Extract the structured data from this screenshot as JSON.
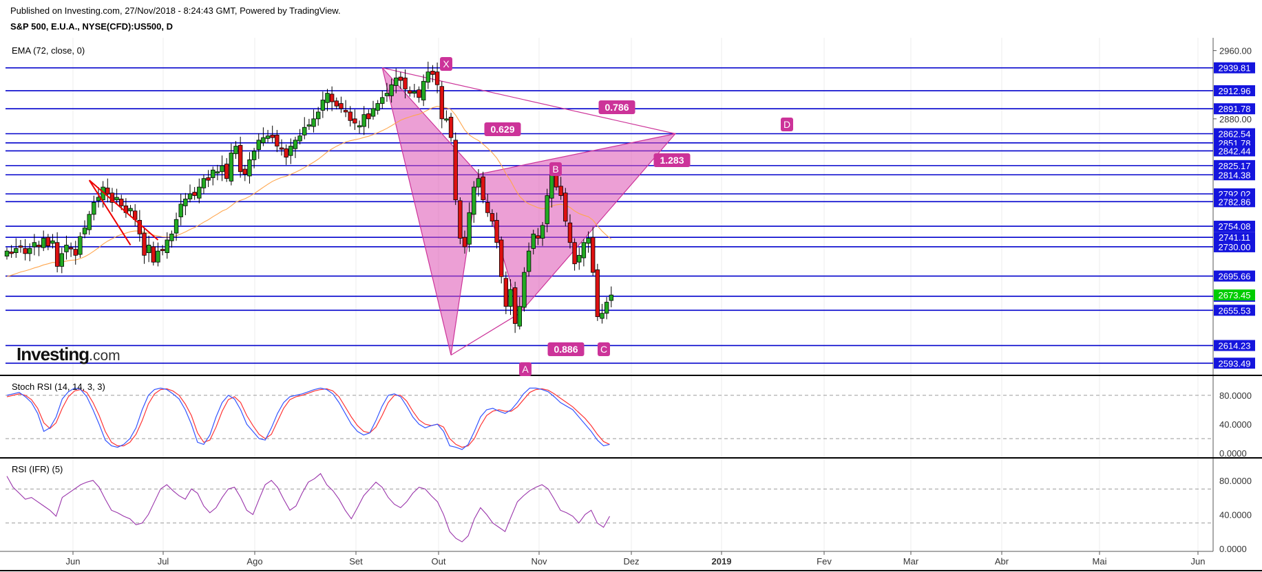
{
  "header": {
    "published": "Published on Investing.com, 27/Nov/2018 - 8:24:43 GMT, Powered by TradingView.",
    "symbol": "S&P 500, E.U.A., NYSE(CFD):US500, D"
  },
  "logo": {
    "main": "Investing",
    "suffix": ".com"
  },
  "colors": {
    "hline": "#0000cc",
    "up": "#22aa22",
    "down": "#dd1111",
    "pattern": "#cc3399",
    "pattern_fill": "rgba(221,80,178,0.55)",
    "ema": "#ffa64d",
    "stoch_k": "#3355ff",
    "stoch_d": "#ff3333",
    "rsi": "#9933aa",
    "current_badge": "#00cc00"
  },
  "main_pane": {
    "indicator_label": "EMA (72, close, 0)",
    "y_ticks": [
      "2960.00",
      "2880.00"
    ],
    "price_levels": [
      "2939.81",
      "2912.96",
      "2891.78",
      "2862.54",
      "2851.78",
      "2842.44",
      "2825.17",
      "2814.38",
      "2792.02",
      "2782.86",
      "2754.08",
      "2741.11",
      "2730.00",
      "2695.66",
      "2671.97",
      "2655.53",
      "2614.23",
      "2593.49"
    ],
    "current_price": "2673.45",
    "pattern_points": [
      "X",
      "A",
      "B",
      "C",
      "D"
    ],
    "ratios": [
      "0.629",
      "0.786",
      "1.283",
      "0.886"
    ]
  },
  "stoch_pane": {
    "label": "Stoch RSI (14, 14, 3, 3)",
    "y_ticks": [
      "80.0000",
      "40.0000",
      "0.0000"
    ]
  },
  "rsi_pane": {
    "label": "RSI (IFR) (5)",
    "y_ticks": [
      "80.0000",
      "40.0000",
      "0.0000"
    ]
  },
  "x_axis": {
    "labels": [
      "Jun",
      "Jul",
      "Ago",
      "Set",
      "Out",
      "Nov",
      "Dez",
      "2019",
      "Fev",
      "Mar",
      "Abr",
      "Mai",
      "Jun"
    ]
  },
  "chart_data": {
    "type": "candlestick",
    "symbol": "S&P 500, E.U.A., NYSE(CFD):US500, D",
    "candles_close": [
      2725,
      2722,
      2728,
      2730,
      2722,
      2728,
      2735,
      2730,
      2740,
      2731,
      2737,
      2707,
      2722,
      2732,
      2728,
      2720,
      2742,
      2752,
      2768,
      2782,
      2788,
      2800,
      2792,
      2782,
      2788,
      2778,
      2770,
      2775,
      2762,
      2745,
      2720,
      2732,
      2712,
      2725,
      2726,
      2738,
      2745,
      2762,
      2780,
      2786,
      2792,
      2790,
      2800,
      2810,
      2808,
      2820,
      2818,
      2825,
      2810,
      2840,
      2848,
      2818,
      2815,
      2832,
      2842,
      2855,
      2858,
      2860,
      2858,
      2848,
      2845,
      2835,
      2848,
      2855,
      2860,
      2870,
      2873,
      2880,
      2888,
      2902,
      2910,
      2900,
      2895,
      2892,
      2888,
      2878,
      2875,
      2872,
      2885,
      2880,
      2892,
      2898,
      2905,
      2910,
      2920,
      2928,
      2925,
      2915,
      2910,
      2912,
      2905,
      2924,
      2935,
      2932,
      2920,
      2880,
      2880,
      2858,
      2785,
      2740,
      2730,
      2770,
      2800,
      2810,
      2785,
      2770,
      2760,
      2735,
      2695,
      2660,
      2680,
      2640,
      2660,
      2700,
      2725,
      2745,
      2740,
      2755,
      2790,
      2815,
      2800,
      2790,
      2760,
      2735,
      2710,
      2720,
      2735,
      2740,
      2700,
      2648,
      2652,
      2665,
      2673.45
    ],
    "ema_72_approx": {
      "start": 2695,
      "oct_peak": 2870,
      "end": 2792
    },
    "harmonic_pattern": {
      "points": [
        {
          "label": "X",
          "price": 2939.81
        },
        {
          "label": "A",
          "price": 2603
        },
        {
          "label": "B",
          "price": 2815
        },
        {
          "label": "C",
          "price": 2652
        },
        {
          "label": "D",
          "price": 2862.54
        }
      ],
      "ratios": {
        "XB": "0.629",
        "XD": "0.786",
        "BD": "1.283",
        "AC": "0.886"
      }
    },
    "stoch_rsi_k": [
      80,
      82,
      84,
      78,
      70,
      55,
      30,
      35,
      50,
      75,
      85,
      90,
      88,
      78,
      60,
      40,
      18,
      10,
      8,
      12,
      20,
      35,
      60,
      80,
      88,
      90,
      88,
      82,
      75,
      60,
      40,
      15,
      12,
      25,
      50,
      70,
      80,
      75,
      60,
      40,
      30,
      20,
      18,
      35,
      55,
      70,
      78,
      80,
      82,
      85,
      88,
      90,
      88,
      82,
      70,
      55,
      40,
      30,
      25,
      28,
      45,
      65,
      80,
      82,
      78,
      65,
      50,
      40,
      35,
      38,
      40,
      30,
      10,
      8,
      5,
      12,
      30,
      50,
      60,
      62,
      58,
      55,
      60,
      70,
      82,
      90,
      90,
      88,
      85,
      78,
      70,
      65,
      60,
      50,
      40,
      30,
      18,
      10,
      12
    ],
    "stoch_rsi_d": [
      78,
      80,
      82,
      80,
      74,
      62,
      42,
      34,
      42,
      62,
      78,
      86,
      88,
      84,
      70,
      52,
      30,
      15,
      10,
      10,
      15,
      26,
      45,
      68,
      82,
      88,
      89,
      86,
      80,
      68,
      52,
      28,
      15,
      18,
      36,
      58,
      74,
      78,
      70,
      52,
      38,
      26,
      20,
      26,
      44,
      62,
      74,
      78,
      80,
      83,
      86,
      88,
      89,
      86,
      78,
      64,
      50,
      38,
      30,
      28,
      36,
      52,
      70,
      80,
      80,
      72,
      58,
      46,
      40,
      38,
      40,
      36,
      20,
      12,
      8,
      10,
      20,
      38,
      52,
      58,
      60,
      58,
      58,
      64,
      74,
      84,
      88,
      89,
      87,
      82,
      76,
      70,
      64,
      56,
      48,
      38,
      26,
      16,
      12
    ],
    "rsi_5": [
      85,
      72,
      65,
      58,
      60,
      55,
      50,
      45,
      38,
      60,
      65,
      70,
      75,
      78,
      80,
      72,
      58,
      45,
      42,
      38,
      35,
      28,
      30,
      40,
      55,
      70,
      75,
      68,
      62,
      58,
      70,
      65,
      50,
      42,
      48,
      60,
      70,
      72,
      60,
      45,
      40,
      58,
      75,
      80,
      72,
      58,
      45,
      50,
      65,
      78,
      82,
      88,
      75,
      68,
      58,
      45,
      35,
      48,
      62,
      70,
      78,
      72,
      60,
      52,
      48,
      55,
      65,
      72,
      70,
      62,
      55,
      40,
      20,
      12,
      8,
      15,
      35,
      48,
      40,
      30,
      25,
      20,
      38,
      55,
      62,
      68,
      72,
      75,
      70,
      58,
      45,
      42,
      38,
      30,
      40,
      45,
      30,
      25,
      38
    ],
    "x_axis_labels": [
      "Jun",
      "Jul",
      "Ago",
      "Set",
      "Out",
      "Nov",
      "Dez",
      "2019",
      "Fev",
      "Mar",
      "Abr",
      "Mai",
      "Jun"
    ],
    "price_levels": [
      2939.81,
      2912.96,
      2891.78,
      2862.54,
      2851.78,
      2842.44,
      2825.17,
      2814.38,
      2792.02,
      2782.86,
      2754.08,
      2741.11,
      2730.0,
      2695.66,
      2671.97,
      2655.53,
      2614.23,
      2593.49
    ],
    "current_price": 2673.45,
    "stoch_ylim": [
      0,
      100
    ],
    "rsi_ylim": [
      0,
      100
    ],
    "grid": true
  }
}
